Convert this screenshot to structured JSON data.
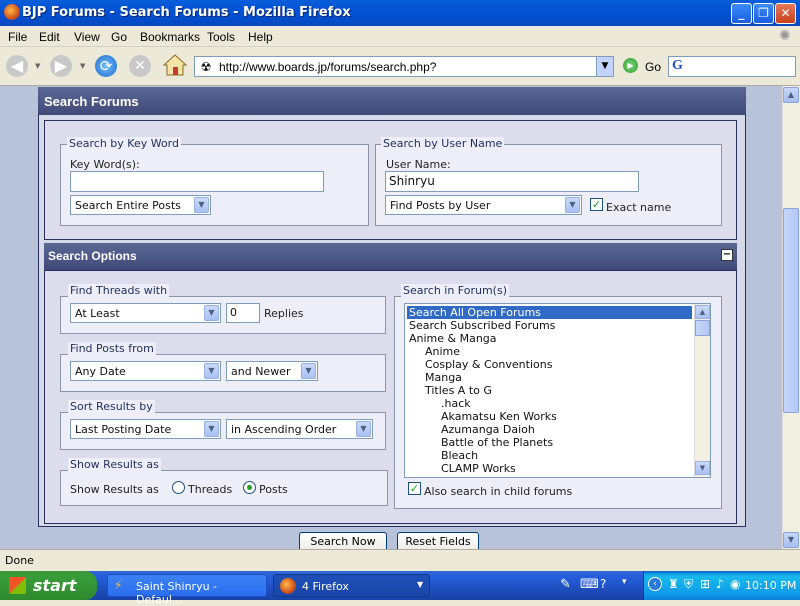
{
  "window": {
    "title": "BJP Forums - Search Forums - Mozilla Firefox"
  },
  "menu": [
    "File",
    "Edit",
    "View",
    "Go",
    "Bookmarks",
    "Tools",
    "Help"
  ],
  "toolbar": {
    "url": "http://www.boards.jp/forums/search.php?",
    "go_label": "Go"
  },
  "page": {
    "title": "Search Forums",
    "keyword_section": {
      "legend": "Search by Key Word",
      "label": "Key Word(s):",
      "value": "",
      "mode": "Search Entire Posts"
    },
    "user_section": {
      "legend": "Search by User Name",
      "label": "User Name:",
      "value": "Shinryu",
      "mode": "Find Posts by User",
      "exact_label": "Exact name",
      "exact_checked": true
    },
    "options": {
      "title": "Search Options",
      "threads": {
        "legend": "Find Threads with",
        "mode": "At Least",
        "count": "0",
        "suffix": "Replies"
      },
      "posts_from": {
        "legend": "Find Posts from",
        "date": "Any Date",
        "direction": "and Newer"
      },
      "sort": {
        "legend": "Sort Results by",
        "field": "Last Posting Date",
        "order": "in Ascending Order"
      },
      "show": {
        "legend": "Show Results as",
        "label": "Show Results as",
        "opt1": "Threads",
        "opt2": "Posts",
        "selected": "Posts"
      },
      "forums": {
        "legend": "Search in Forum(s)",
        "items": [
          "Search All Open Forums",
          "Search Subscribed Forums",
          "Anime & Manga",
          "Anime",
          "Cosplay & Conventions",
          "Manga",
          "Titles A to G",
          ".hack",
          "Akamatsu Ken Works",
          "Azumanga Daioh",
          "Battle of the Planets",
          "Bleach",
          "CLAMP Works"
        ],
        "selected_index": 0,
        "child_label": "Also search in child forums",
        "child_checked": true
      }
    },
    "buttons": {
      "search": "Search Now",
      "reset": "Reset Fields"
    }
  },
  "status": {
    "text": "Done"
  },
  "taskbar": {
    "start": "start",
    "tasks": [
      "Saint Shinryu - Defaul...",
      "4 Firefox"
    ],
    "clock": "10:10 PM"
  }
}
